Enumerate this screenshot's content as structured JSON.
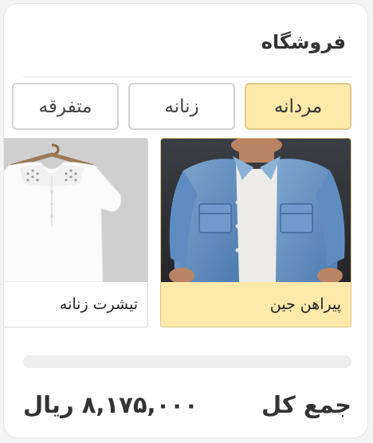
{
  "header": {
    "title": "فروشگاه"
  },
  "tabs": [
    {
      "label": "مردانه",
      "active": true
    },
    {
      "label": "زنانه",
      "active": false
    },
    {
      "label": "متفرقه",
      "active": false
    }
  ],
  "products": [
    {
      "name": "پیراهن جین",
      "image": "denim-shirt-image",
      "selected": true
    },
    {
      "name": "تیشرت زنانه",
      "image": "white-blouse-image",
      "selected": false
    }
  ],
  "summary": {
    "total_label": "جمع کل",
    "total_value": "۸,۱۷۵,۰۰۰ ریال"
  },
  "colors": {
    "accent": "#fde9aa",
    "accent_border": "#dcc98a",
    "text": "#333333"
  }
}
